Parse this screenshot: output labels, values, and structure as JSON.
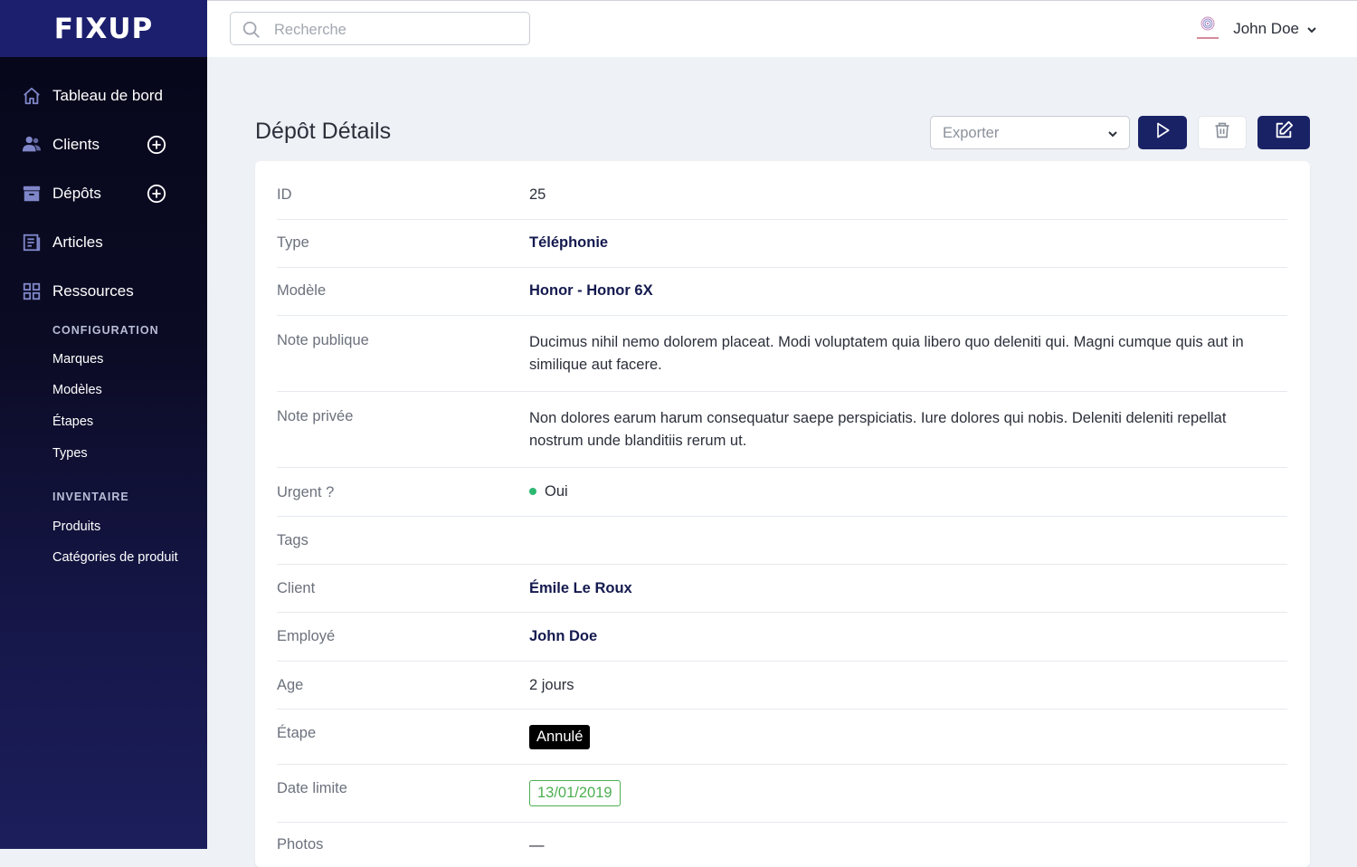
{
  "brand": {
    "logo_text": "FIXUP"
  },
  "sidebar": {
    "nav": [
      {
        "label": "Tableau de bord",
        "icon": "home-icon"
      },
      {
        "label": "Clients",
        "icon": "users-icon",
        "has_add": true
      },
      {
        "label": "Dépôts",
        "icon": "archive-icon",
        "has_add": true
      },
      {
        "label": "Articles",
        "icon": "newspaper-icon"
      },
      {
        "label": "Ressources",
        "icon": "grid-icon"
      }
    ],
    "sections": [
      {
        "title": "CONFIGURATION",
        "items": [
          "Marques",
          "Modèles",
          "Étapes",
          "Types"
        ]
      },
      {
        "title": "INVENTAIRE",
        "items": [
          "Produits",
          "Catégories de produit"
        ]
      }
    ]
  },
  "topbar": {
    "search_placeholder": "Recherche",
    "user_name": "John Doe"
  },
  "header": {
    "title": "Dépôt Détails",
    "export_label": "Exporter"
  },
  "details": [
    {
      "label": "ID",
      "value": "25"
    },
    {
      "label": "Type",
      "value": "Téléphonie"
    },
    {
      "label": "Modèle",
      "value": "Honor - Honor 6X"
    },
    {
      "label": "Note publique",
      "value": "Ducimus nihil nemo dolorem placeat. Modi voluptatem quia libero quo deleniti qui. Magni cumque quis aut in similique aut facere."
    },
    {
      "label": "Note privée",
      "value": "Non dolores earum harum consequatur saepe perspiciatis. Iure dolores qui nobis. Deleniti deleniti repellat nostrum unde blanditiis rerum ut."
    },
    {
      "label": "Urgent ?",
      "value": "Oui"
    },
    {
      "label": "Tags",
      "value": ""
    },
    {
      "label": "Client",
      "value": "Émile Le Roux"
    },
    {
      "label": "Employé",
      "value": "John Doe"
    },
    {
      "label": "Age",
      "value": "2 jours"
    },
    {
      "label": "Étape",
      "value": "Annulé"
    },
    {
      "label": "Date limite",
      "value": "13/01/2019"
    },
    {
      "label": "Photos",
      "value": "—"
    }
  ],
  "colors": {
    "accent": "#1a2266",
    "urgent_dot": "#2eb872",
    "date_badge": "#4caf50"
  }
}
